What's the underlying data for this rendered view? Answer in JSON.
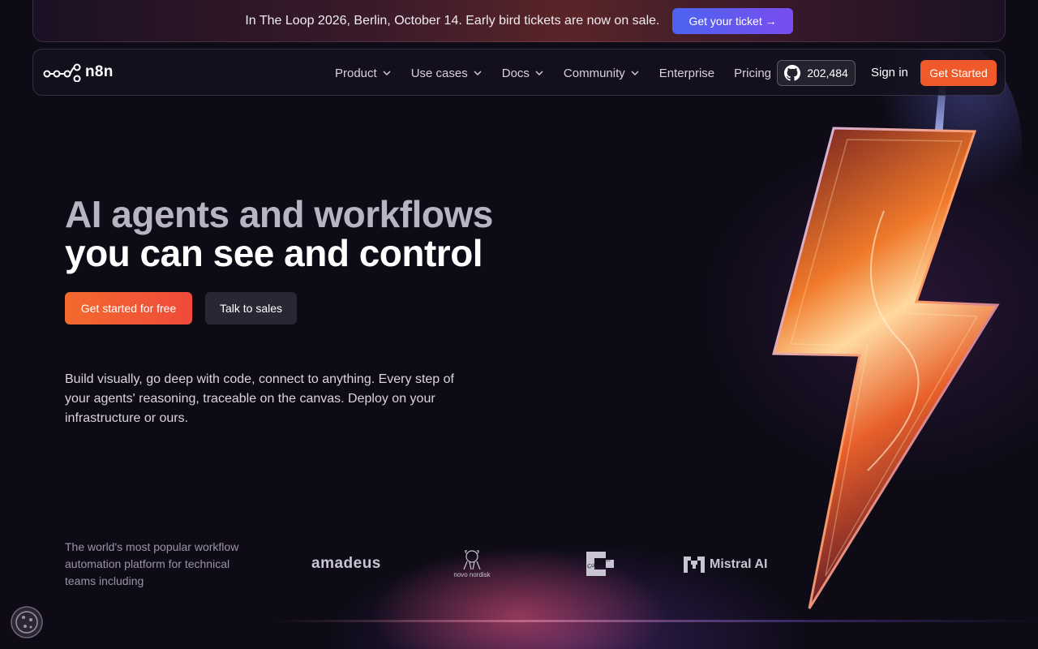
{
  "announcement": {
    "text": "In The Loop 2026, Berlin, October 14. Early bird tickets are now on sale.",
    "button_label": "Get your ticket →"
  },
  "nav": {
    "logo_text": "n8n",
    "items": [
      {
        "label": "Product",
        "dropdown": true
      },
      {
        "label": "Use cases",
        "dropdown": true
      },
      {
        "label": "Docs",
        "dropdown": true
      },
      {
        "label": "Community",
        "dropdown": true
      },
      {
        "label": "Enterprise",
        "dropdown": false
      },
      {
        "label": "Pricing",
        "dropdown": false
      }
    ],
    "github_stars": "202,484",
    "signin_label": "Sign in",
    "get_started_label": "Get Started"
  },
  "hero": {
    "headline_line1": "AI agents and workflows",
    "headline_line2": "you can see and control",
    "cta_primary": "Get started for free",
    "cta_secondary": "Talk to sales",
    "subcopy": "Build visually, go deep with code, connect to anything. Every step of your agents' reasoning, traceable on the canvas. Deploy on your infrastructure or ours."
  },
  "trusted": {
    "text": "The world's most popular workflow automation platform for technical teams including",
    "brands": [
      "amadeus",
      "novo nordisk",
      "Cummins",
      "Mistral AI"
    ]
  },
  "colors": {
    "accent_orange": "#f0592a",
    "ticket_blue": "#4b63f0",
    "background": "#0e0b17"
  },
  "icons": [
    "n8n-logo-icon",
    "chevron-down-icon",
    "github-icon",
    "arrow-right-icon",
    "lightning-bolt-icon",
    "cookie-icon"
  ]
}
